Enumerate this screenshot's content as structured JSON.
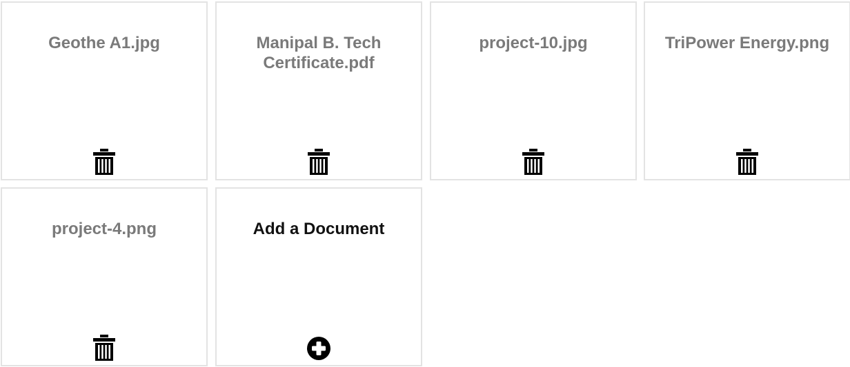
{
  "documents": [
    {
      "name": "Geothe A1.jpg",
      "action_icon": "trash-icon"
    },
    {
      "name": "Manipal B. Tech Certificate.pdf",
      "action_icon": "trash-icon"
    },
    {
      "name": "project-10.jpg",
      "action_icon": "trash-icon"
    },
    {
      "name": "TriPower Energy.png",
      "action_icon": "trash-icon"
    },
    {
      "name": "project-4.png",
      "action_icon": "trash-icon"
    }
  ],
  "add_tile": {
    "label": "Add a Document",
    "action_icon": "plus-circle-icon"
  },
  "colors": {
    "border": "#e3e3e3",
    "doc_text": "#7a7a7a",
    "add_text": "#111111",
    "icon": "#000000"
  }
}
